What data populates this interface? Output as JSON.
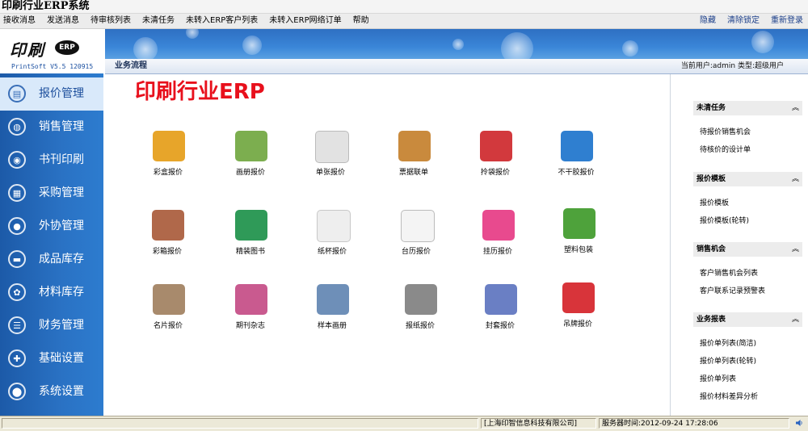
{
  "window": {
    "title": "印刷行业ERP系统"
  },
  "menu": {
    "left": [
      "接收消息",
      "发送消息",
      "待审核列表",
      "未清任务",
      "未转入ERP客户列表",
      "未转入ERP网络订单",
      "帮助"
    ],
    "right": [
      "隐藏",
      "清除锁定",
      "重新登录"
    ]
  },
  "logo": {
    "brand": "印刷",
    "badge": "ERP",
    "version": "PrintSoft V5.5 120915"
  },
  "subbar": {
    "title": "业务流程",
    "user_info": "当前用户:admin 类型:超级用户"
  },
  "sidebar": {
    "items": [
      {
        "label": "报价管理",
        "icon": "quote-icon",
        "active": true
      },
      {
        "label": "销售管理",
        "icon": "globe-icon",
        "active": false
      },
      {
        "label": "书刊印刷",
        "icon": "chrome-icon",
        "active": false
      },
      {
        "label": "采购管理",
        "icon": "calculator-icon",
        "active": false
      },
      {
        "label": "外协管理",
        "icon": "record-icon",
        "active": false
      },
      {
        "label": "成品库存",
        "icon": "storage-icon",
        "active": false
      },
      {
        "label": "材料库存",
        "icon": "palette-icon",
        "active": false
      },
      {
        "label": "财务管理",
        "icon": "ledger-icon",
        "active": false
      },
      {
        "label": "基础设置",
        "icon": "settings-icon",
        "active": false
      },
      {
        "label": "系统设置",
        "icon": "system-icon",
        "active": false
      }
    ]
  },
  "main": {
    "title": "印刷行业ERP",
    "tiles": [
      {
        "label": "彩盒报价",
        "icon": "box-icon",
        "color": "#e7a52a"
      },
      {
        "label": "画册报价",
        "icon": "album-icon",
        "color": "#7cae4f"
      },
      {
        "label": "单张报价",
        "icon": "list-icon",
        "color": "#9a9a9a"
      },
      {
        "label": "票据联单",
        "icon": "folder-icon",
        "color": "#c98a3d"
      },
      {
        "label": "拎袋报价",
        "icon": "bag-icon",
        "color": "#d2393d"
      },
      {
        "label": "不干胶报价",
        "icon": "sunflower-icon",
        "color": "#f1b418"
      },
      {
        "label": "彩箱报价",
        "icon": "carton-icon",
        "color": "#b0684a"
      },
      {
        "label": "精装图书",
        "icon": "book-icon",
        "color": "#2f9a58"
      },
      {
        "label": "纸杯报价",
        "icon": "cup-icon",
        "color": "#dcdcdc"
      },
      {
        "label": "台历报价",
        "icon": "calendar-icon",
        "color": "#c0c0c0"
      },
      {
        "label": "挂历报价",
        "icon": "flickr-icon",
        "color": "#e84a8e"
      },
      {
        "label": "塑料包装",
        "icon": "dw-icon",
        "color": "#4ea23b"
      },
      {
        "label": "名片报价",
        "icon": "card-icon",
        "color": "#a88a6c"
      },
      {
        "label": "期刊杂志",
        "icon": "magazine-icon",
        "color": "#c95a8f"
      },
      {
        "label": "样本画册",
        "icon": "sample-icon",
        "color": "#6e8fb8"
      },
      {
        "label": "报纸报价",
        "icon": "newspaper-icon",
        "color": "#8a8a8a"
      },
      {
        "label": "封套报价",
        "icon": "envelope-icon",
        "color": "#6a7fc4"
      },
      {
        "label": "吊牌报价",
        "icon": "tag-icon",
        "color": "#d8343a"
      }
    ]
  },
  "right_panel": {
    "sections": [
      {
        "title": "未清任务",
        "collapse": "︽",
        "links": [
          "待报价销售机会",
          "待核价的设计单"
        ]
      },
      {
        "title": "报价模板",
        "collapse": "︽",
        "links": [
          "报价模板",
          "报价模板(轮转)"
        ]
      },
      {
        "title": "销售机会",
        "collapse": "︽",
        "links": [
          "客户销售机会列表",
          "客户联系记录预警表"
        ]
      },
      {
        "title": "业务报表",
        "collapse": "︽",
        "links": [
          "报价单列表(简洁)",
          "报价单列表(轮转)",
          "报价单列表",
          "报价材料差异分析"
        ]
      }
    ]
  },
  "status": {
    "company": "[上海印智信息科技有限公司]",
    "server_time": "服务器时间:2012-09-24 17:28:06"
  },
  "colors": {
    "accent": "#2d7ccf",
    "title_red": "#e8101c"
  }
}
